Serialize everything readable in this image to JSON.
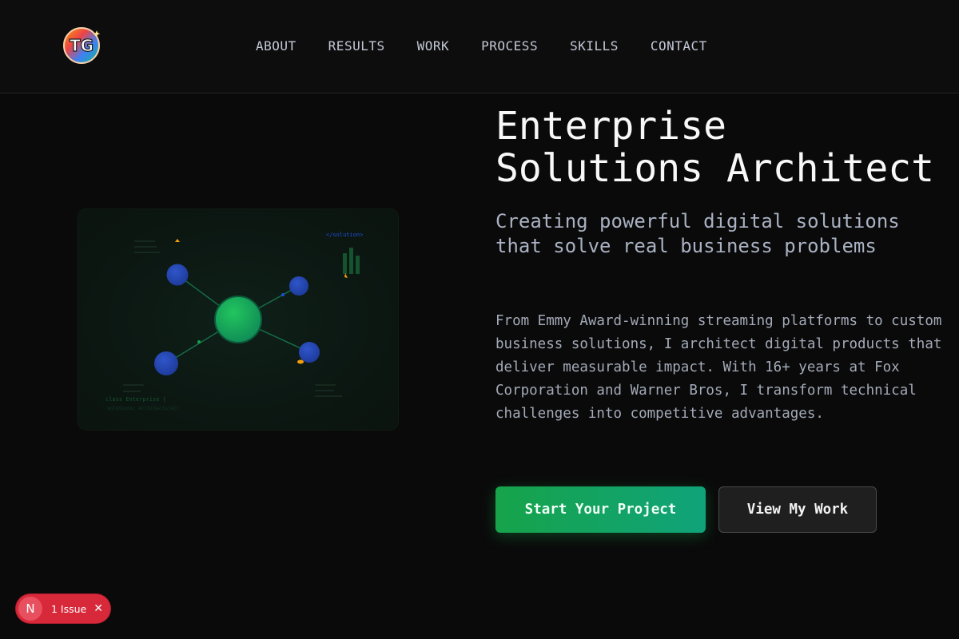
{
  "header": {
    "logo_text": "TG",
    "nav": [
      {
        "label": "ABOUT"
      },
      {
        "label": "RESULTS"
      },
      {
        "label": "WORK"
      },
      {
        "label": "PROCESS"
      },
      {
        "label": "SKILLS"
      },
      {
        "label": "CONTACT"
      }
    ]
  },
  "illustration": {
    "code_tag": "</solution>",
    "code_line_1": "class Enterprise {",
    "code_line_2": "  solutions: Architecture[]"
  },
  "hero": {
    "title": "Enterprise Solutions Architect",
    "subtitle": "Creating powerful digital solutions that solve real business problems",
    "body": "From Emmy Award-winning streaming platforms to custom business solutions, I architect digital products that deliver measurable impact. With 16+ years at Fox Corporation and Warner Bros, I transform technical challenges into competitive advantages.",
    "primary_cta": "Start Your Project",
    "secondary_cta": "View My Work"
  },
  "dev_overlay": {
    "logo_letter": "N",
    "issue_label": "1 Issue",
    "close_glyph": "✕"
  },
  "colors": {
    "accent_green": "#16a34a",
    "node_blue": "#1e40af",
    "issue_red": "#d8293b"
  }
}
